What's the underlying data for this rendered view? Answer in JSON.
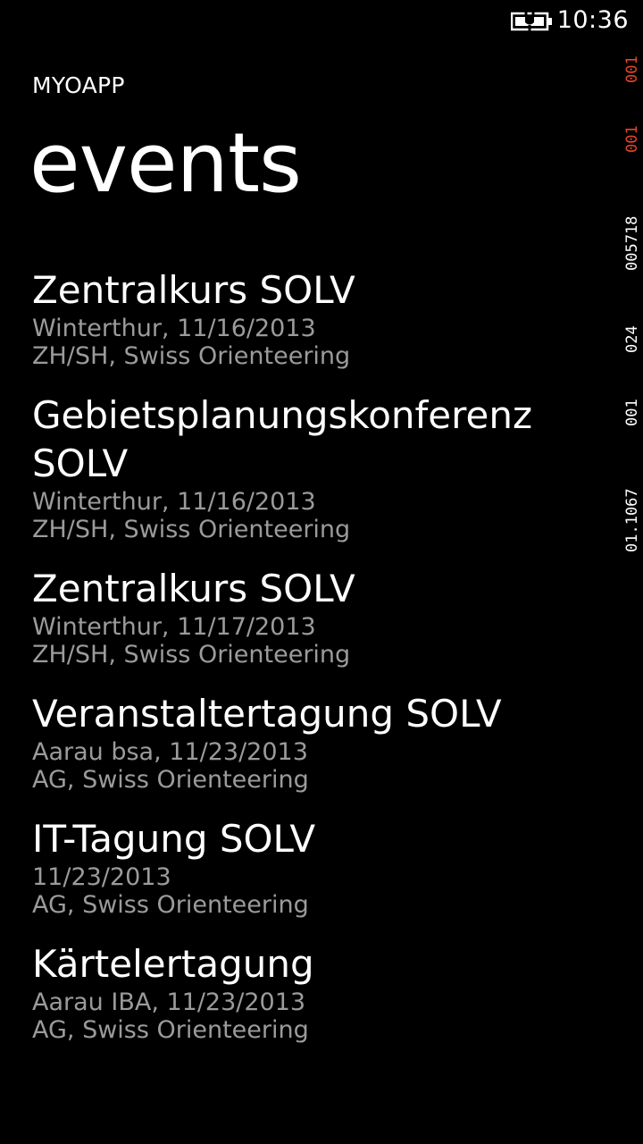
{
  "status_bar": {
    "time": "10:36",
    "battery_icon": "battery-charging-icon"
  },
  "debug_counters": [
    "001",
    "001",
    "005718",
    "024",
    "001",
    "01.1067"
  ],
  "header": {
    "app_title": "MYOAPP",
    "page_title": "events"
  },
  "events": [
    {
      "name": "Zentralkurs SOLV",
      "place_date": "Winterthur, 11/16/2013",
      "organizer": "ZH/SH, Swiss Orienteering"
    },
    {
      "name": "Gebietsplanungskonferenz SOLV",
      "place_date": "Winterthur, 11/16/2013",
      "organizer": "ZH/SH, Swiss Orienteering"
    },
    {
      "name": "Zentralkurs SOLV",
      "place_date": "Winterthur, 11/17/2013",
      "organizer": "ZH/SH, Swiss Orienteering"
    },
    {
      "name": "Veranstaltertagung SOLV",
      "place_date": "Aarau bsa, 11/23/2013",
      "organizer": "AG, Swiss Orienteering"
    },
    {
      "name": "IT-Tagung SOLV",
      "place_date": "11/23/2013",
      "organizer": "AG, Swiss Orienteering"
    },
    {
      "name": "Kärtelertagung",
      "place_date": "Aarau IBA, 11/23/2013",
      "organizer": "AG, Swiss Orienteering"
    }
  ],
  "colors": {
    "background": "#000000",
    "primary_text": "#ffffff",
    "secondary_text": "#9b9b9b",
    "counter_accent": "#e2462a"
  }
}
